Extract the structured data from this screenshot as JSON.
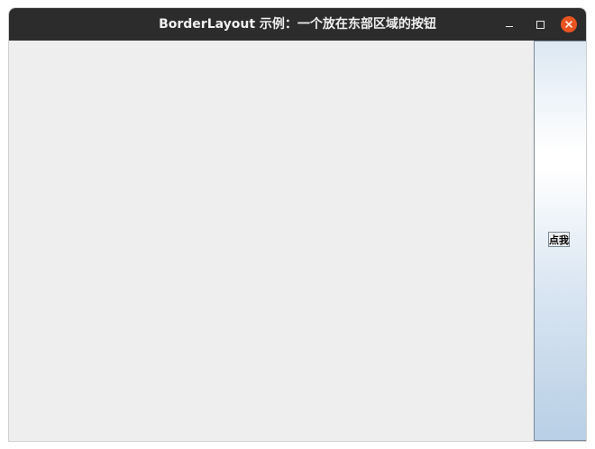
{
  "window": {
    "title": "BorderLayout 示例：一个放在东部区域的按钮",
    "controls": {
      "minimize_icon": "minimize-icon",
      "maximize_icon": "maximize-icon",
      "close_icon": "close-icon"
    }
  },
  "east": {
    "button_label": "点我"
  },
  "colors": {
    "titlebar": "#2c2c2c",
    "close_button": "#e95420",
    "content_background": "#eeeeee",
    "button_border": "#7a8a99"
  }
}
